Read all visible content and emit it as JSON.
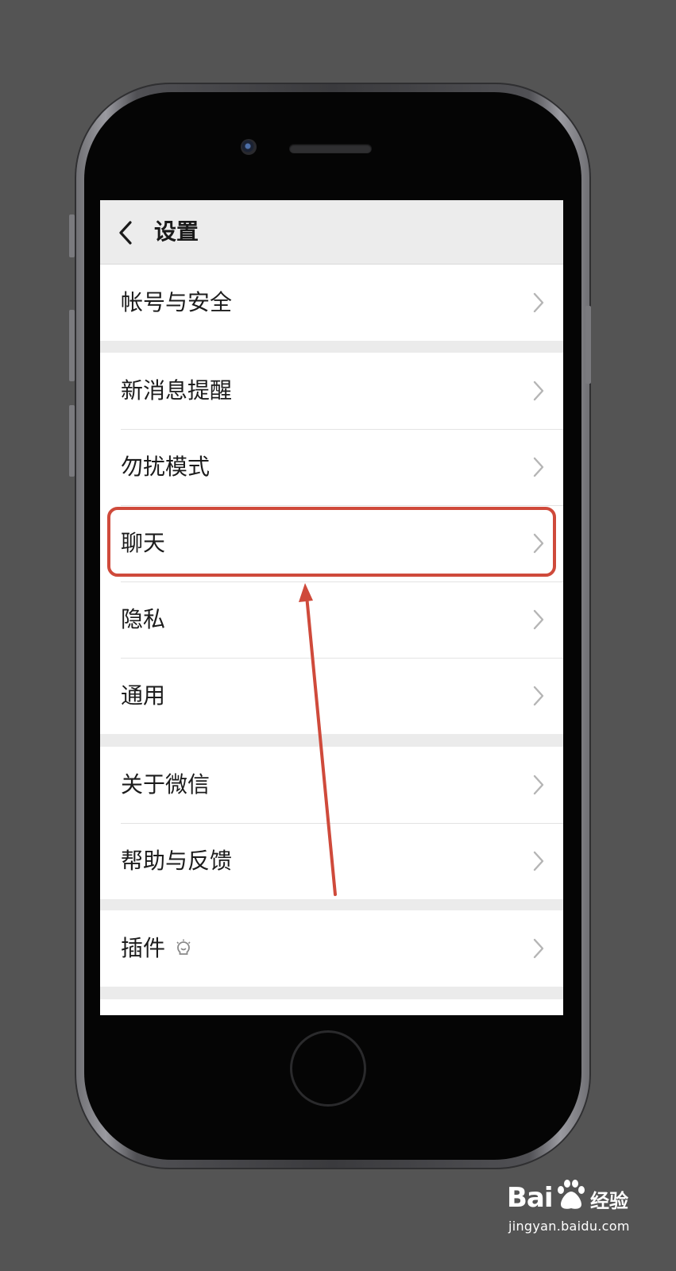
{
  "nav": {
    "title": "设置"
  },
  "groups": [
    {
      "items": [
        {
          "label": "帐号与安全"
        }
      ]
    },
    {
      "items": [
        {
          "label": "新消息提醒"
        },
        {
          "label": "勿扰模式"
        },
        {
          "label": "聊天"
        },
        {
          "label": "隐私"
        },
        {
          "label": "通用"
        }
      ]
    },
    {
      "items": [
        {
          "label": "关于微信"
        },
        {
          "label": "帮助与反馈"
        }
      ]
    },
    {
      "items": [
        {
          "label": "插件"
        }
      ]
    }
  ],
  "annotation": {
    "highlighted_item": "聊天",
    "color": "#cf4a3b"
  },
  "watermark": {
    "brand": "Bai",
    "suffix": "经验",
    "url": "jingyan.baidu.com"
  },
  "colors": {
    "background": "#545454",
    "screen_bg": "#ebebeb",
    "row_bg": "#ffffff",
    "chevron": "#b5b5b5"
  },
  "icons": {
    "back": "chevron-left-icon",
    "row": "chevron-right-icon",
    "plugin": "plugin-bulb-icon"
  }
}
